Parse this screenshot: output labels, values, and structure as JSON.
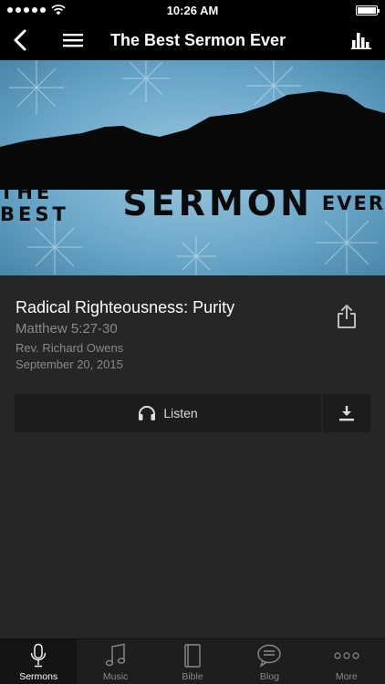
{
  "status_bar": {
    "time": "10:26 AM"
  },
  "nav": {
    "title": "The Best Sermon Ever"
  },
  "banner": {
    "line_left": "THE BEST",
    "line_main": "SERMON",
    "line_right": "EVER"
  },
  "sermon": {
    "title": "Radical Righteousness: Purity",
    "passage": "Matthew 5:27-30",
    "speaker": "Rev. Richard Owens",
    "date": "September 20, 2015"
  },
  "actions": {
    "listen_label": "Listen"
  },
  "tabs": [
    {
      "label": "Sermons",
      "icon": "microphone-icon",
      "active": true
    },
    {
      "label": "Music",
      "icon": "music-note-icon",
      "active": false
    },
    {
      "label": "Bible",
      "icon": "book-icon",
      "active": false
    },
    {
      "label": "Blog",
      "icon": "chat-bubble-icon",
      "active": false
    },
    {
      "label": "More",
      "icon": "more-dots-icon",
      "active": false
    }
  ],
  "colors": {
    "background": "#262626",
    "bar": "#000000",
    "muted_text": "#8a8a8a",
    "banner_sky": "#6aa6c8"
  }
}
